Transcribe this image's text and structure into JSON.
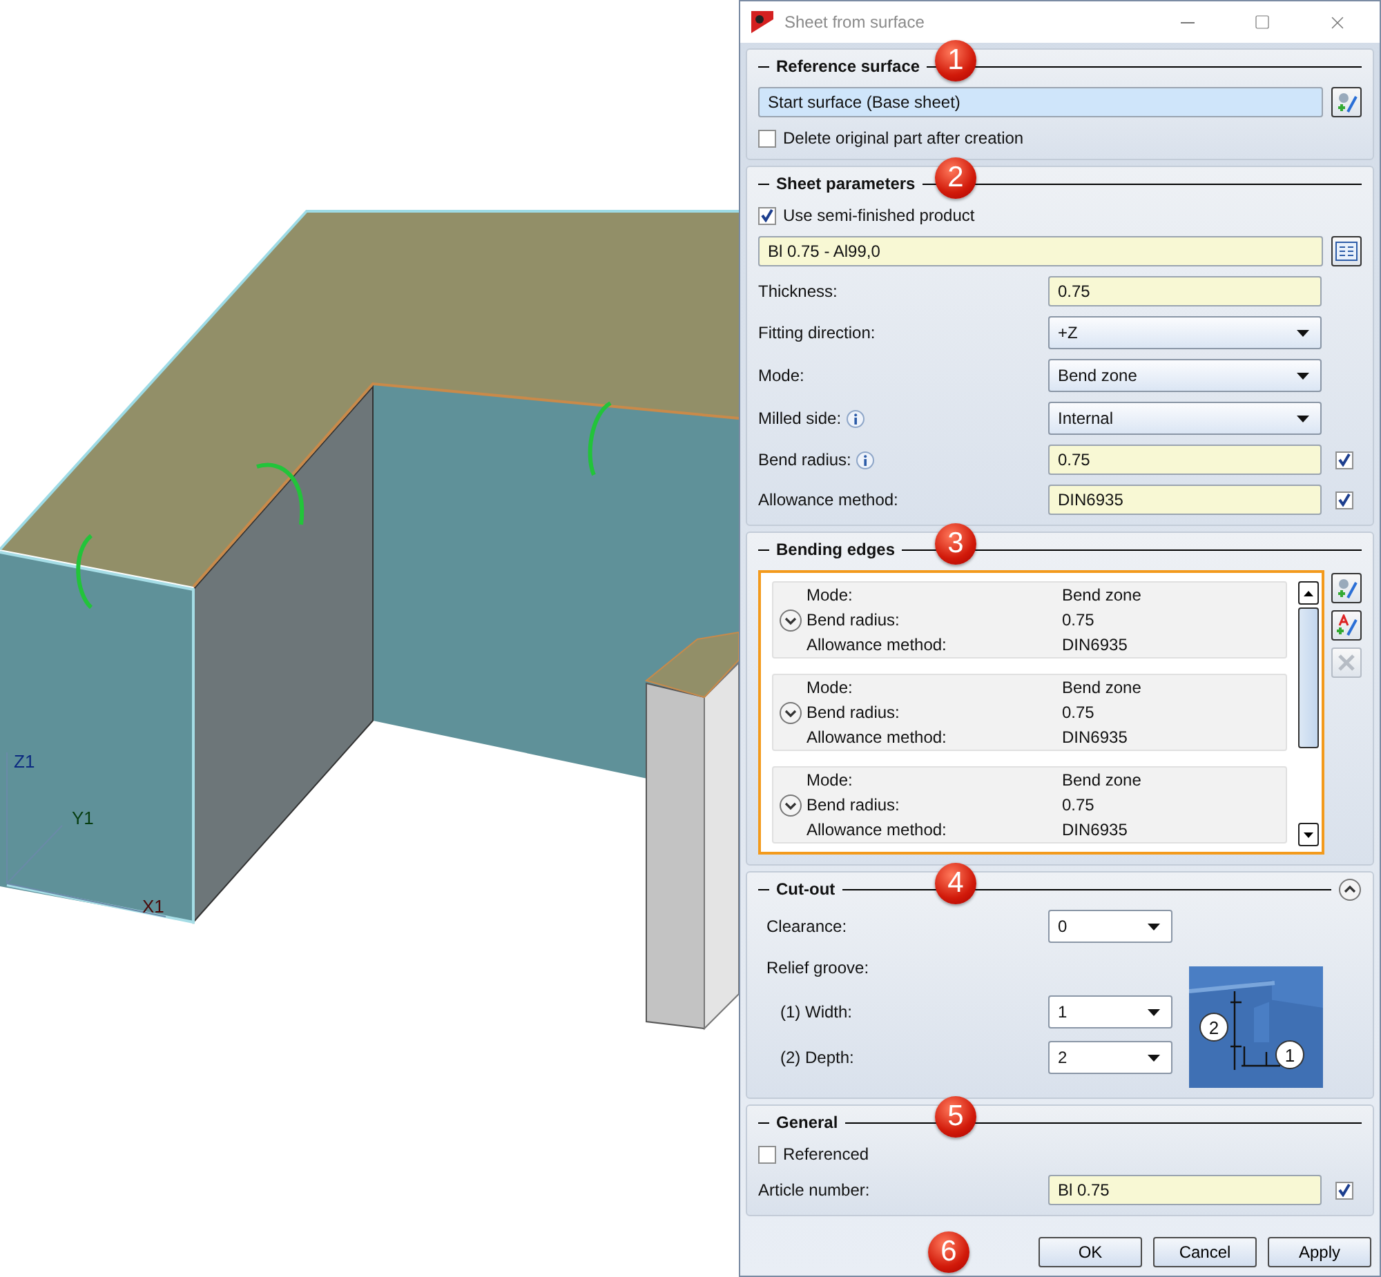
{
  "viewport": {
    "axis_labels": [
      {
        "text": "Z1"
      },
      {
        "text": "Y1"
      },
      {
        "text": "X1"
      }
    ]
  },
  "dialog": {
    "title": "Sheet from surface"
  },
  "sections": [
    {
      "kind": "reference",
      "title": "Reference surface",
      "marker": "1",
      "selection": "Start surface (Base sheet)",
      "checkbox": {
        "label": "Delete original part after creation",
        "checked": false
      }
    },
    {
      "kind": "sheet",
      "title": "Sheet parameters",
      "marker": "2",
      "checkbox": {
        "label": "Use semi-finished product",
        "checked": true
      },
      "material": "Bl 0.75 - Al99,0",
      "fields": [
        {
          "label": "Thickness:",
          "kind": "text",
          "value": "0.75"
        },
        {
          "label": "Fitting direction:",
          "kind": "dropdown",
          "value": "+Z"
        },
        {
          "label": "Mode:",
          "kind": "dropdown",
          "value": "Bend zone"
        },
        {
          "label": "Milled side:",
          "info": true,
          "kind": "dropdown",
          "value": "Internal"
        },
        {
          "label": "Bend radius:",
          "info": true,
          "kind": "text",
          "value": "0.75",
          "checked": true
        },
        {
          "label": "Allowance method:",
          "kind": "text",
          "value": "DIN6935",
          "checked": true
        }
      ]
    },
    {
      "kind": "edges",
      "title": "Bending edges",
      "marker": "3",
      "edges": [
        {
          "expanded": false,
          "rows": [
            {
              "label": "Mode:",
              "value": "Bend zone"
            },
            {
              "label": "Bend radius:",
              "value": "0.75"
            },
            {
              "label": "Allowance method:",
              "value": "DIN6935"
            }
          ]
        },
        {
          "expanded": false,
          "rows": [
            {
              "label": "Mode:",
              "value": "Bend zone"
            },
            {
              "label": "Bend radius:",
              "value": "0.75"
            },
            {
              "label": "Allowance method:",
              "value": "DIN6935"
            }
          ]
        },
        {
          "expanded": false,
          "rows": [
            {
              "label": "Mode:",
              "value": "Bend zone"
            },
            {
              "label": "Bend radius:",
              "value": "0.75"
            },
            {
              "label": "Allowance method:",
              "value": "DIN6935"
            }
          ]
        }
      ]
    },
    {
      "kind": "cutout",
      "title": "Cut-out",
      "marker": "4",
      "expanded": true,
      "clearance": {
        "label": "Clearance:",
        "value": "0"
      },
      "relief_label": "Relief groove:",
      "fields": [
        {
          "label": "(1) Width:",
          "value": "1"
        },
        {
          "label": "(2) Depth:",
          "value": "2"
        }
      ],
      "diagram_labels": [
        "2",
        "1"
      ]
    },
    {
      "kind": "general",
      "title": "General",
      "marker": "5",
      "checkbox": {
        "label": "Referenced",
        "checked": false
      },
      "fields": [
        {
          "label": "Article number:",
          "kind": "text",
          "value": "Bl 0.75",
          "checked": true
        }
      ]
    }
  ],
  "footer": {
    "marker": "6",
    "buttons": [
      "OK",
      "Cancel",
      "Apply"
    ]
  }
}
